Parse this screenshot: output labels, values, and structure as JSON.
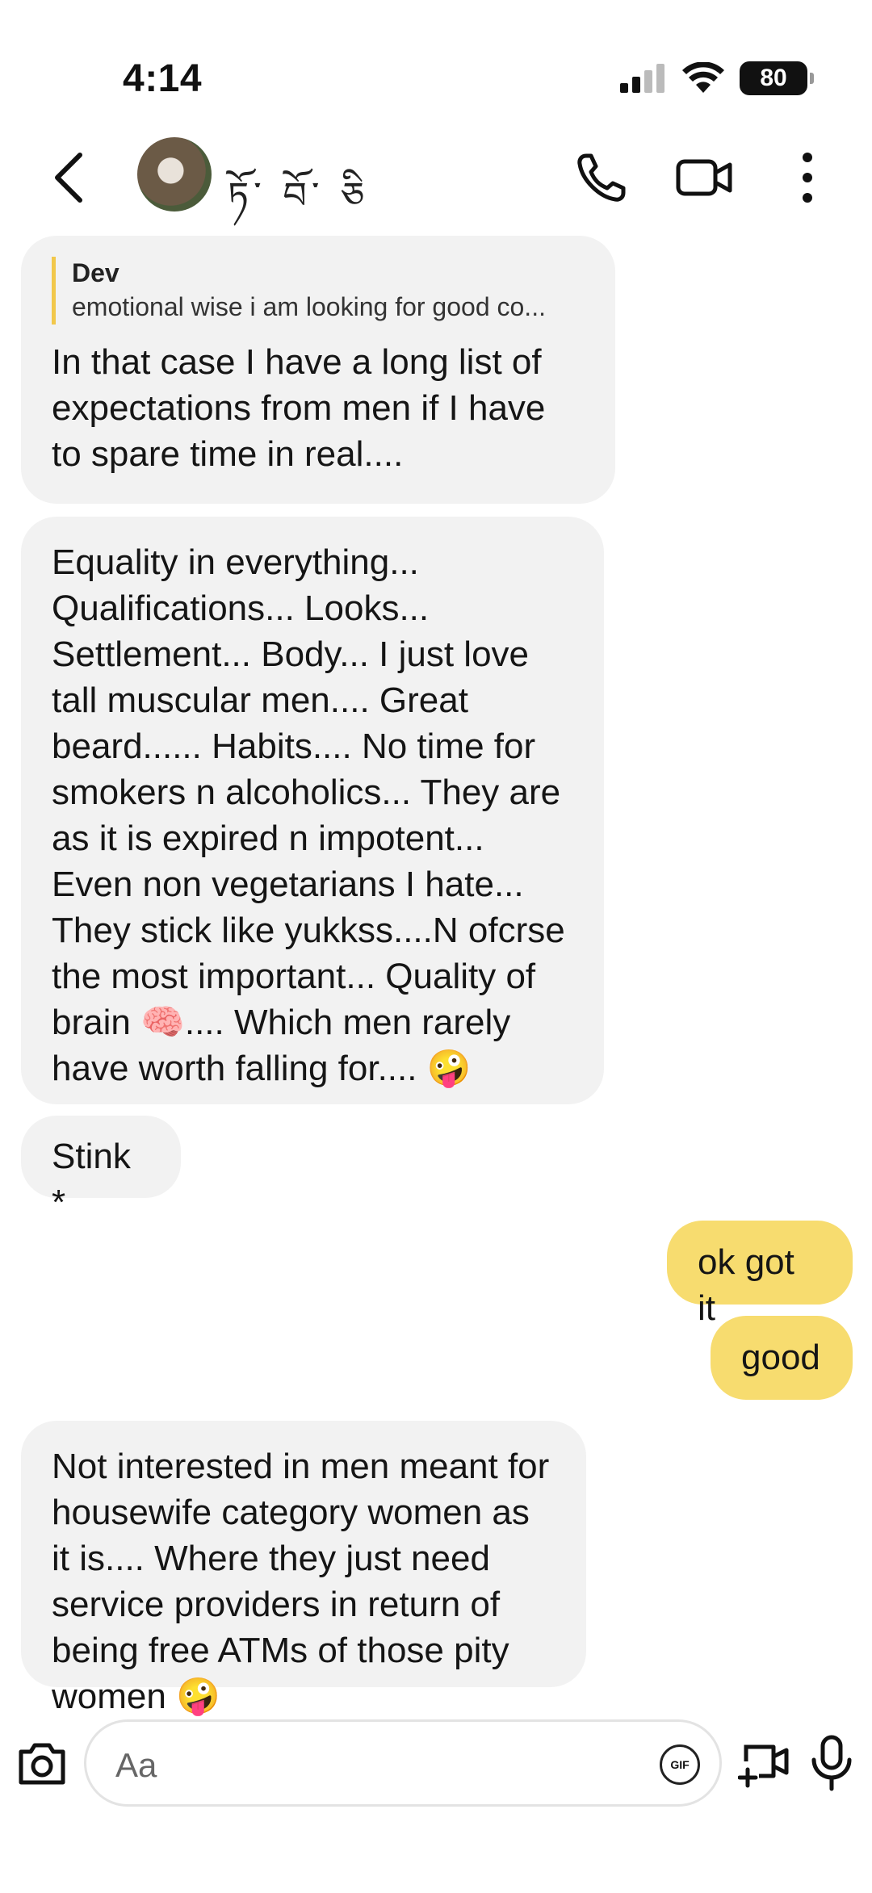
{
  "status_bar": {
    "time": "4:14",
    "battery": "80"
  },
  "header": {
    "contact_name": "ཏོ་ བོ་ ཅི"
  },
  "messages": [
    {
      "direction": "in",
      "reply_to": {
        "author": "Dev",
        "text": "emotional wise i am looking for good co..."
      },
      "text": "In that case I have a long list of expectations from men if I have to spare time in real...."
    },
    {
      "direction": "in",
      "text": "Equality in everything... Qualifications... Looks... Settlement... Body... I just love tall muscular men.... Great beard...... Habits.... No time for smokers n alcoholics... They are as it is expired n impotent... Even non vegetarians I hate... They stick like yukkss....N ofcrse the most important... Quality of brain 🧠.... Which men rarely have worth falling for.... 🤪"
    },
    {
      "direction": "in",
      "text": "Stink *"
    },
    {
      "direction": "out",
      "text": "ok got it"
    },
    {
      "direction": "out",
      "text": "good"
    },
    {
      "direction": "in",
      "text": "Not interested in men meant for housewife category women as it is.... Where they just need service providers in return of being free ATMs of those pity women 🤪"
    }
  ],
  "composer": {
    "placeholder": "Aa",
    "gif_label": "GIF"
  },
  "colors": {
    "incoming_bubble": "#f2f2f2",
    "outgoing_bubble": "#f7dc6f",
    "quote_bar": "#f2c84b"
  }
}
